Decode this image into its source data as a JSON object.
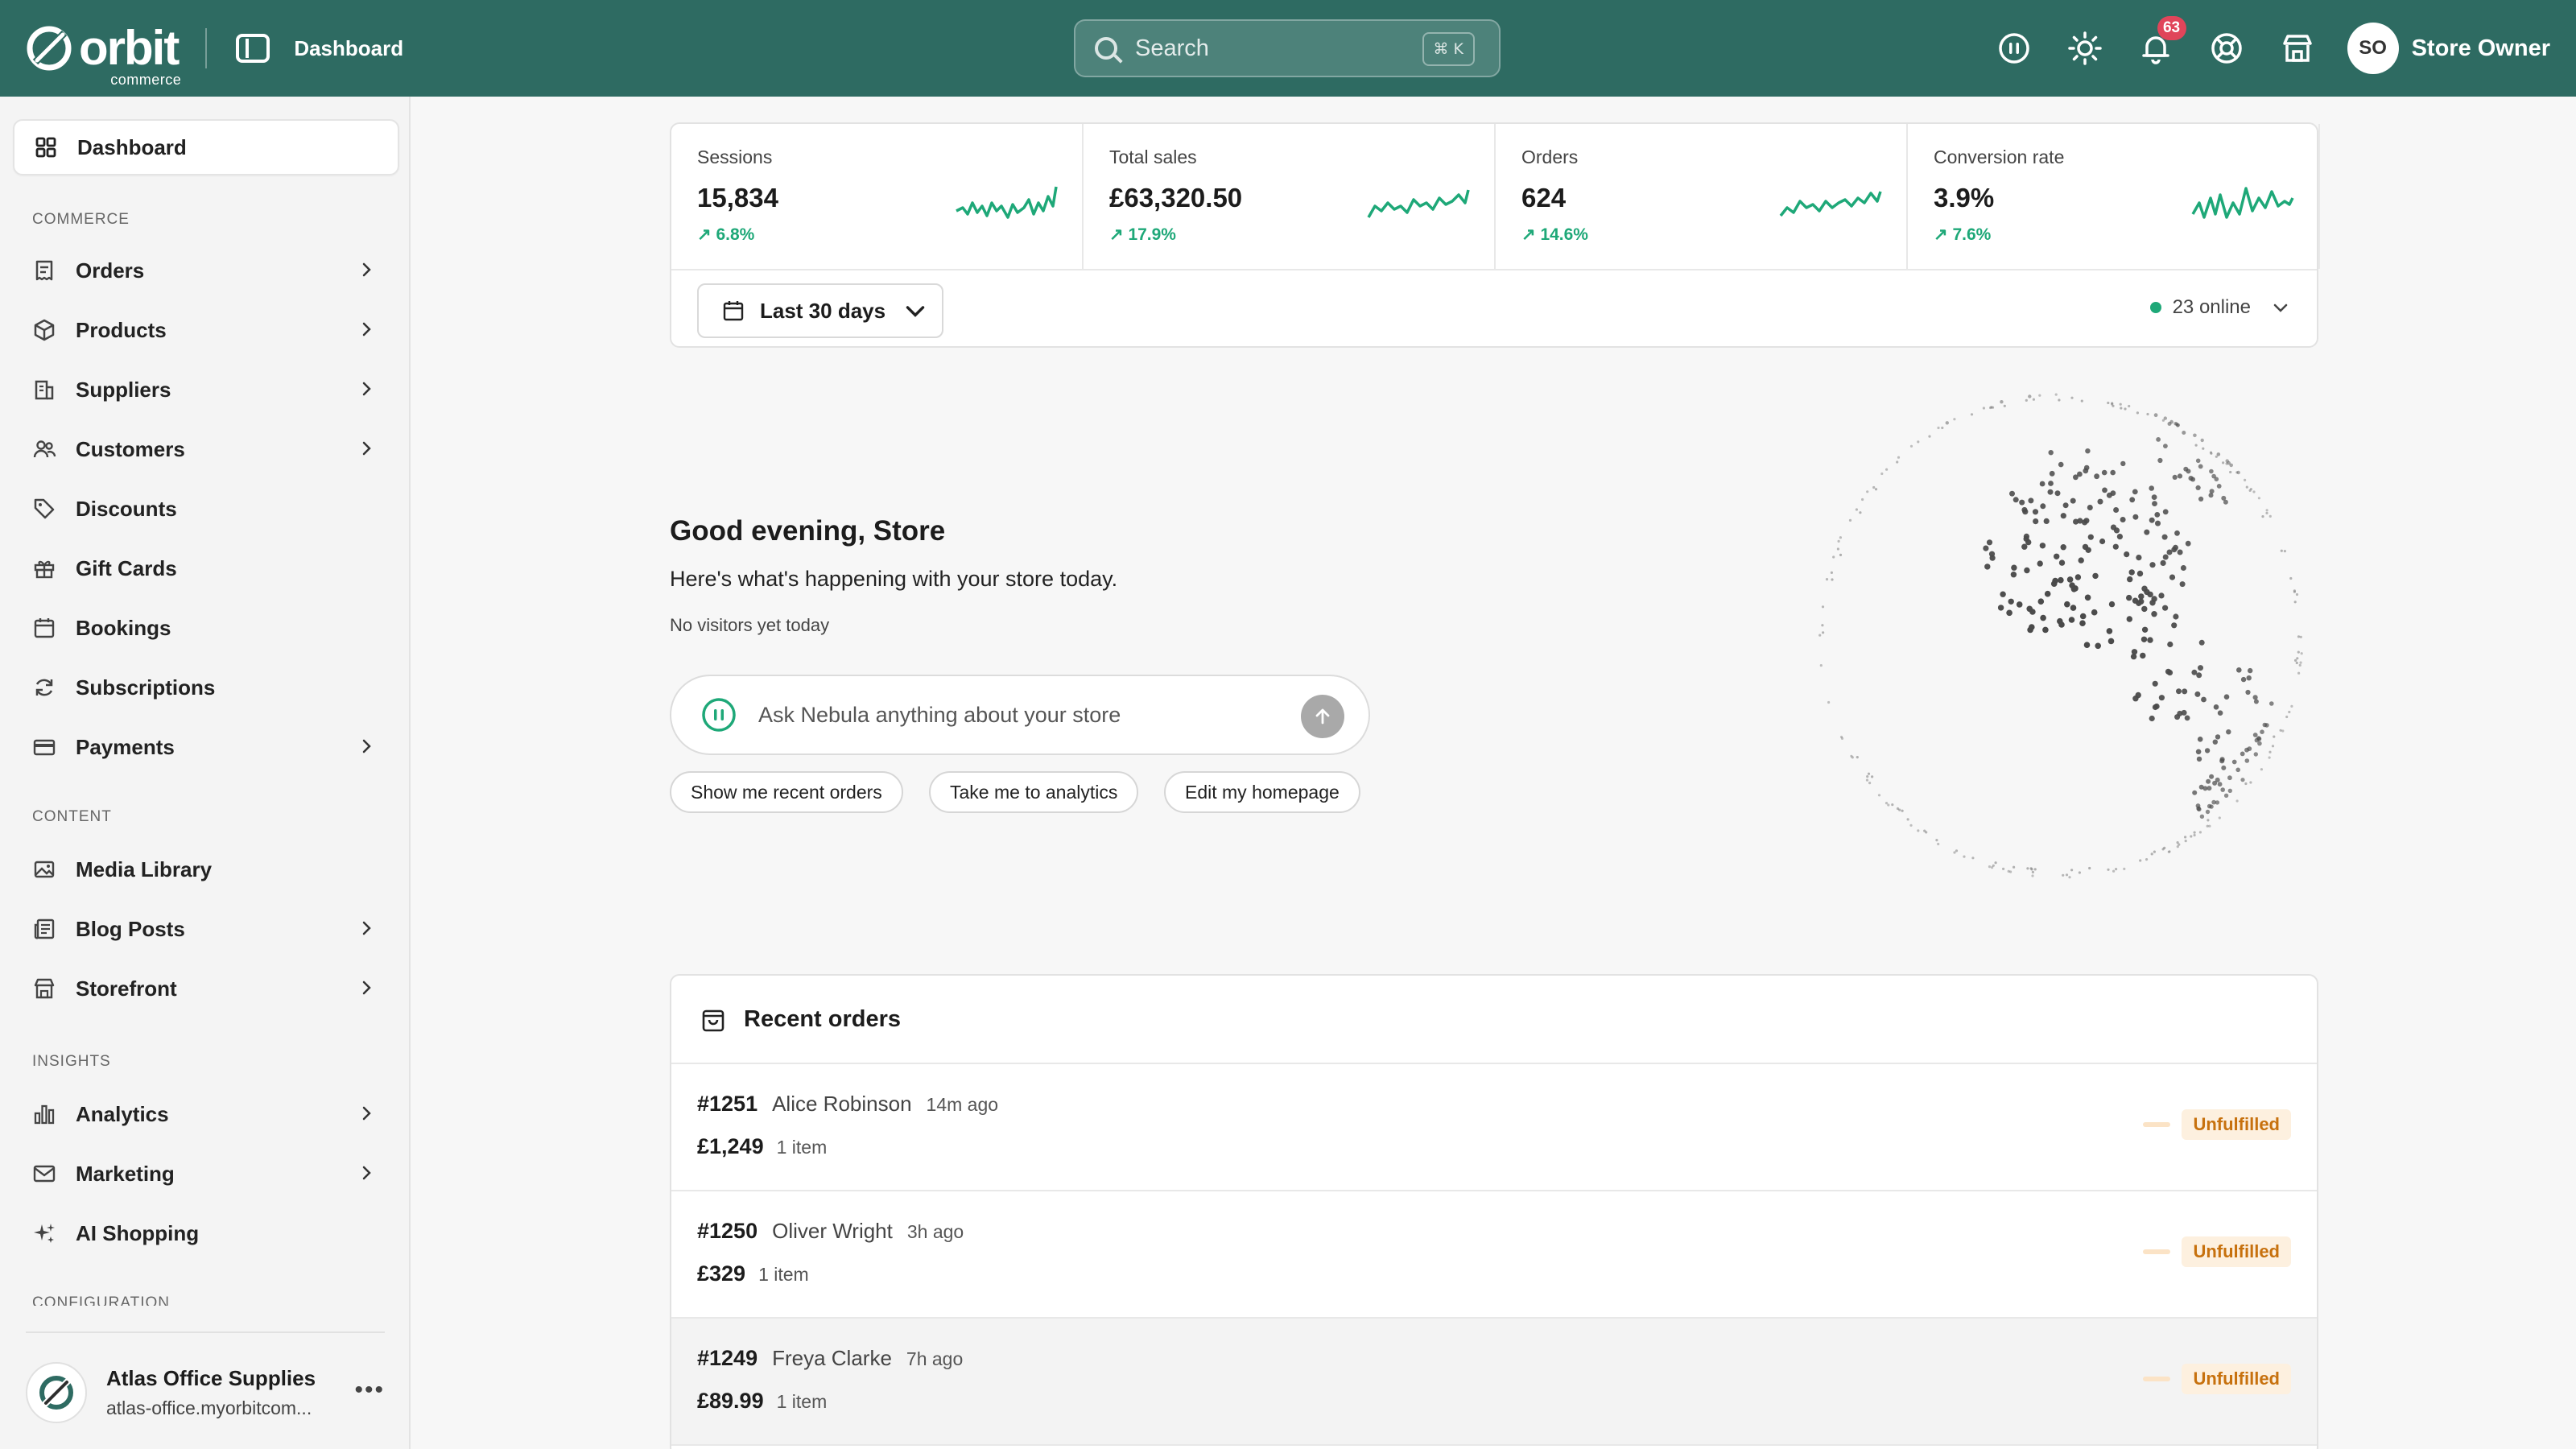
{
  "brand": {
    "name": "orbit",
    "sub": "commerce"
  },
  "topbar": {
    "page_title": "Dashboard",
    "search_placeholder": "Search",
    "search_shortcut": "⌘ K",
    "notification_count": "63",
    "user_initials": "SO",
    "user_name": "Store Owner"
  },
  "sidebar": {
    "active_label": "Dashboard",
    "sections": {
      "commerce": "COMMERCE",
      "content": "CONTENT",
      "insights": "INSIGHTS",
      "configuration": "CONFIGURATION"
    },
    "commerce_items": [
      "Orders",
      "Products",
      "Suppliers",
      "Customers",
      "Discounts",
      "Gift Cards",
      "Bookings",
      "Subscriptions",
      "Payments"
    ],
    "content_items": [
      "Media Library",
      "Blog Posts",
      "Storefront"
    ],
    "insights_items": [
      "Analytics",
      "Marketing",
      "AI Shopping"
    ],
    "store": {
      "name": "Atlas Office Supplies",
      "url": "atlas-office.myorbitcom..."
    }
  },
  "stats": [
    {
      "label": "Sessions",
      "value": "15,834",
      "change": "6.8%"
    },
    {
      "label": "Total sales",
      "value": "£63,320.50",
      "change": "17.9%"
    },
    {
      "label": "Orders",
      "value": "624",
      "change": "14.6%"
    },
    {
      "label": "Conversion rate",
      "value": "3.9%",
      "change": "7.6%"
    }
  ],
  "filters": {
    "date_range": "Last 30 days",
    "online": "23 online"
  },
  "welcome": {
    "greeting": "Good evening, Store",
    "subtext": "Here's what's happening with your store today.",
    "visitors": "No visitors yet today",
    "ask_placeholder": "Ask Nebula anything about your store",
    "chips": [
      "Show me recent orders",
      "Take me to analytics",
      "Edit my homepage"
    ]
  },
  "orders": {
    "title": "Recent orders",
    "rows": [
      {
        "id": "#1251",
        "customer": "Alice Robinson",
        "time": "14m ago",
        "total": "£1,249",
        "items": "1 item",
        "status": "Unfulfilled"
      },
      {
        "id": "#1250",
        "customer": "Oliver Wright",
        "time": "3h ago",
        "total": "£329",
        "items": "1 item",
        "status": "Unfulfilled"
      },
      {
        "id": "#1249",
        "customer": "Freya Clarke",
        "time": "7h ago",
        "total": "£89.99",
        "items": "1 item",
        "status": "Unfulfilled"
      }
    ]
  },
  "colors": {
    "topbar": "#2e6b62",
    "positive": "#1ea878",
    "status_text": "#c7710e",
    "status_bg": "#fdf0df",
    "badge": "#e0455a"
  }
}
